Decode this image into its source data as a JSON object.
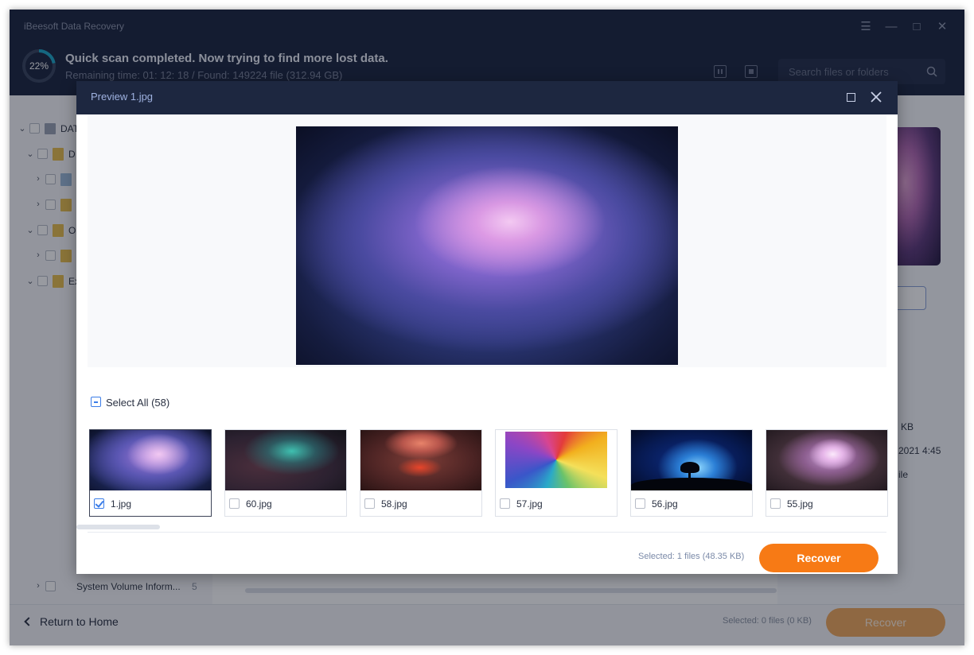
{
  "app": {
    "title": "iBeesoft Data Recovery"
  },
  "header": {
    "progress_percent": "22%",
    "scan_title": "Quick scan completed. Now trying to find more lost data.",
    "scan_subtitle": "Remaining time: 01: 12: 18 / Found: 149224 file (312.94 GB)",
    "search_placeholder": "Search files or folders"
  },
  "tree": {
    "items": [
      {
        "label": "DAT"
      },
      {
        "label": "D"
      },
      {
        "label": ""
      },
      {
        "label": ""
      },
      {
        "label": "O"
      },
      {
        "label": ""
      },
      {
        "label": "Ex"
      },
      {
        "label": "System Volume Inform...",
        "count": "5"
      }
    ]
  },
  "details": {
    "size_fragment": "KB",
    "date_fragment": "2021 4:45",
    "type_fragment": "ile"
  },
  "footer": {
    "back_label": "Return to Home",
    "selected": "Selected: 0 files (0 KB)",
    "recover_label": "Recover"
  },
  "modal": {
    "title": "Preview 1.jpg",
    "select_all_label": "Select All (58)",
    "thumbnails": [
      {
        "name": "1.jpg",
        "checked": true
      },
      {
        "name": "60.jpg",
        "checked": false
      },
      {
        "name": "58.jpg",
        "checked": false
      },
      {
        "name": "57.jpg",
        "checked": false
      },
      {
        "name": "56.jpg",
        "checked": false
      },
      {
        "name": "55.jpg",
        "checked": false
      }
    ],
    "selected": "Selected: 1 files (48.35 KB)",
    "recover_label": "Recover"
  },
  "colors": {
    "header_bg": "#1d2740",
    "accent_orange": "#f77a15",
    "accent_blue": "#3b7de8",
    "progress_ring": "#1ea7c8"
  },
  "icons": {
    "menu": "hamburger-icon",
    "minimize": "minimize-icon",
    "maximize": "maximize-icon",
    "close": "close-icon",
    "search": "search-icon",
    "pause": "pause-icon",
    "stop": "stop-icon",
    "back": "chevron-left-icon"
  }
}
